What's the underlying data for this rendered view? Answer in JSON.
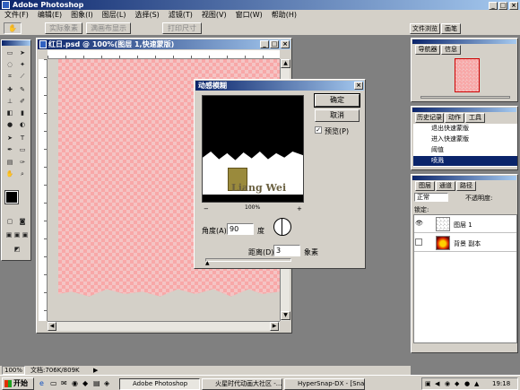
{
  "app": {
    "title": "Adobe Photoshop"
  },
  "menu": [
    "文件(F)",
    "编辑(E)",
    "图象(I)",
    "图层(L)",
    "选择(S)",
    "滤镜(T)",
    "视图(V)",
    "窗口(W)",
    "帮助(H)"
  ],
  "options": {
    "buttons": [
      "实际象素",
      "满画布显示",
      "打印尺寸"
    ],
    "tabs": [
      "文件浏览",
      "画笔"
    ]
  },
  "document": {
    "title": "红日.psd @ 100%(图层 1,快速蒙版)"
  },
  "dialog": {
    "title": "动感模糊",
    "ok": "确定",
    "cancel": "取消",
    "preview": "预览(P)",
    "zoom": "100%",
    "angle_label": "角度(A):",
    "angle_value": "90",
    "angle_unit": "度",
    "distance_label": "距离(D):",
    "distance_value": "3",
    "distance_unit": "象素",
    "watermark": "Liang Wei"
  },
  "navigator": {
    "tabs": [
      "导航器",
      "信息"
    ]
  },
  "history": {
    "tabs": [
      "历史记录",
      "动作",
      "工具"
    ],
    "items": [
      "退出快速蒙版",
      "进入快速蒙版",
      "阈值",
      "喷溅"
    ]
  },
  "layers": {
    "tabs": [
      "图层",
      "通道",
      "路径"
    ],
    "mode": "正常",
    "opacity_label": "不透明度:",
    "lock_label": "锁定:",
    "items": [
      "图层 1",
      "背景 副本"
    ]
  },
  "status": {
    "zoom": "100%",
    "doc": "文档:706K/809K"
  },
  "taskbar": {
    "start": "开始",
    "tasks": [
      "Adobe Photoshop",
      "火星时代动画大社区 -...",
      "HyperSnap-DX - [Snap8.j..."
    ],
    "clock": "19:18"
  }
}
